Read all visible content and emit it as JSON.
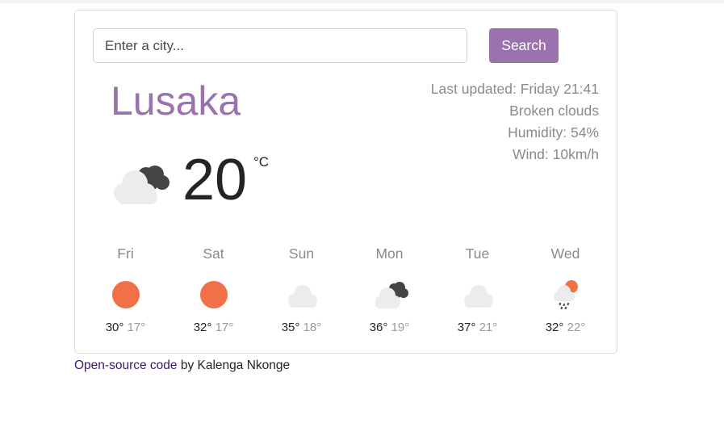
{
  "search": {
    "placeholder": "Enter a city...",
    "button_label": "Search"
  },
  "current": {
    "city": "Lusaka",
    "temperature": "20",
    "unit": "°C",
    "icon": "broken-clouds-icon",
    "last_updated": "Last updated: Friday 21:41",
    "description": "Broken clouds",
    "humidity": "Humidity: 54%",
    "wind": "Wind: 10km/h"
  },
  "forecast": [
    {
      "day": "Fri",
      "max": "30°",
      "min": "17°",
      "icon": "sun-icon"
    },
    {
      "day": "Sat",
      "max": "32°",
      "min": "17°",
      "icon": "sun-icon"
    },
    {
      "day": "Sun",
      "max": "35°",
      "min": "18°",
      "icon": "cloud-icon"
    },
    {
      "day": "Mon",
      "max": "36°",
      "min": "19°",
      "icon": "broken-clouds-icon"
    },
    {
      "day": "Tue",
      "max": "37°",
      "min": "21°",
      "icon": "cloud-icon"
    },
    {
      "day": "Wed",
      "max": "32°",
      "min": "22°",
      "icon": "rain-sun-icon"
    }
  ],
  "footer": {
    "link_text": "Open-source code",
    "author_text": " by Kalenga Nkonge"
  },
  "colors": {
    "accent": "#9a72ad",
    "sun": "#f07048",
    "cloud_light": "#ececec",
    "cloud_dark": "#444444"
  }
}
